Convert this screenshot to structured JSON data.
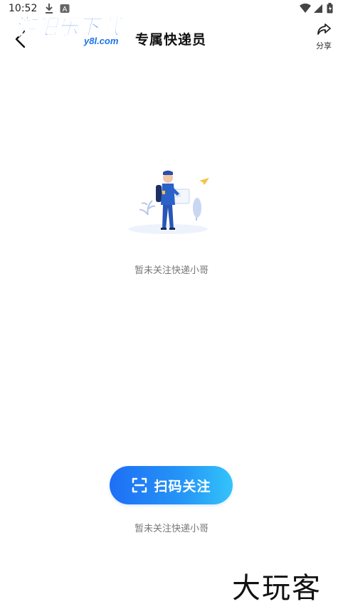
{
  "status_bar": {
    "time": "10:52"
  },
  "header": {
    "title": "专属快递员",
    "share_label": "分享"
  },
  "watermark": {
    "brand": "游吧乐下载",
    "domain": "y8l.com",
    "bottom": "大玩客"
  },
  "empty_state": {
    "message": "暂未关注快递小哥"
  },
  "scan_button": {
    "label": "扫码关注"
  },
  "footer": {
    "message": "暂未关注快递小哥"
  },
  "colors": {
    "accent_start": "#1e6ff5",
    "accent_end": "#33c4fa",
    "muted_text": "#777777"
  }
}
